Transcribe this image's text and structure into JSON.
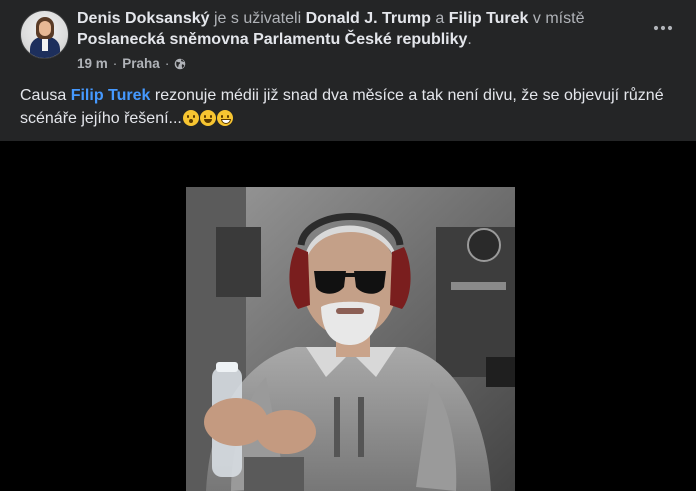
{
  "post": {
    "author": "Denis Doksanský",
    "with_text": "je s uživateli",
    "tagged_1": "Donald J. Trump",
    "and_text": "a",
    "tagged_2": "Filip Turek",
    "place_text": "v místě",
    "place": "Poslanecká sněmovna Parlamentu České republiky",
    "period": ".",
    "time": "19 m",
    "dot": "·",
    "location": "Praha",
    "dot2": "·",
    "body_prefix": "Causa",
    "body_mention": "Filip Turek",
    "body_rest": "rezonuje médii již snad dva měsíce a tak není divu, že se objevují různé scénáře jejího řešení...",
    "emojis": [
      "shushing-face-emoji",
      "grinning-sweat-emoji",
      "grinning-face-emoji"
    ]
  },
  "colors": {
    "background": "#242526",
    "text": "#e4e6eb",
    "secondary_text": "#b0b3b8",
    "mention": "#4599ff",
    "media_bg": "#000000"
  },
  "icons": {
    "privacy": "globe-icon",
    "menu": "more-options-icon"
  }
}
